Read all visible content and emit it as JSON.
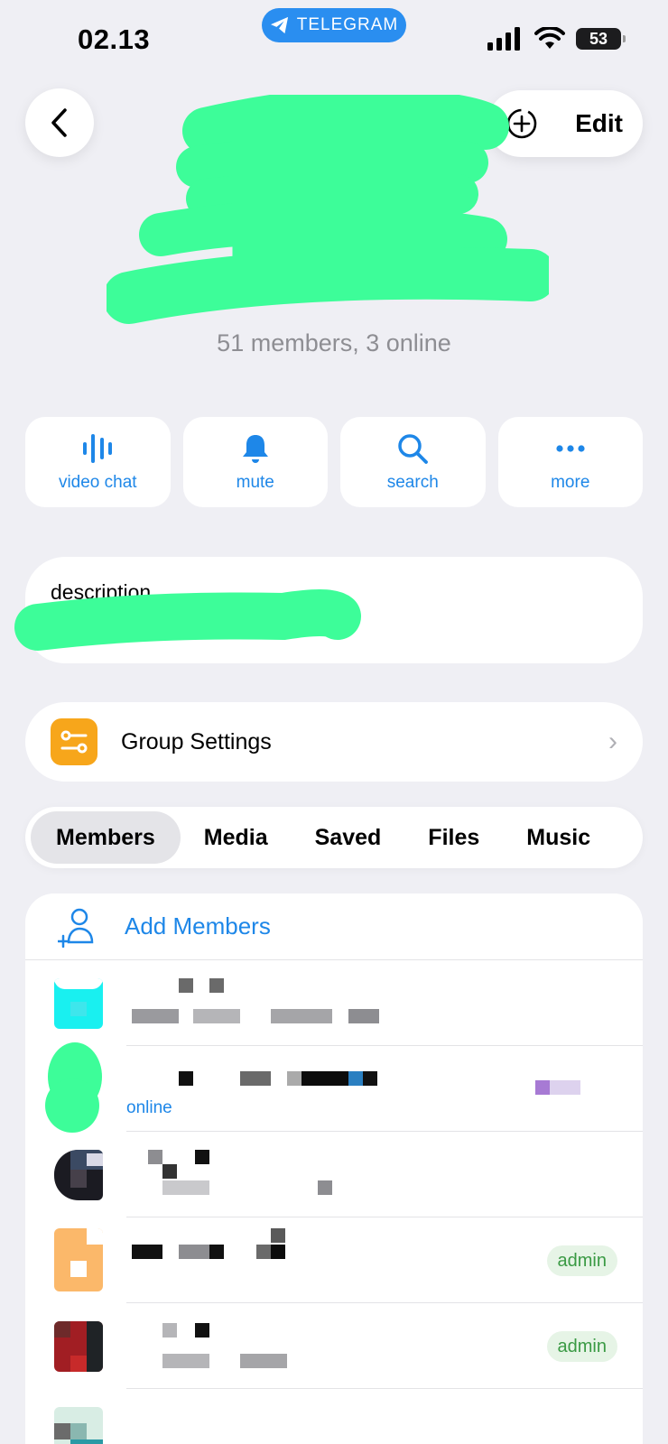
{
  "status_bar": {
    "time": "02.13",
    "app_label": "TELEGRAM",
    "battery": "53"
  },
  "header": {
    "edit_label": "Edit"
  },
  "group": {
    "subtitle": "51 members, 3 online"
  },
  "actions": [
    {
      "label": "video chat",
      "icon": "voice-wave-icon"
    },
    {
      "label": "mute",
      "icon": "bell-icon"
    },
    {
      "label": "search",
      "icon": "magnifier-icon"
    },
    {
      "label": "more",
      "icon": "more-dots-icon"
    }
  ],
  "description": {
    "label": "description"
  },
  "settings": {
    "label": "Group Settings"
  },
  "tabs": [
    {
      "label": "Members",
      "active": true
    },
    {
      "label": "Media"
    },
    {
      "label": "Saved"
    },
    {
      "label": "Files"
    },
    {
      "label": "Music"
    }
  ],
  "members": {
    "add_label": "Add Members",
    "rows": [
      {
        "status": ""
      },
      {
        "status": "online"
      },
      {
        "status": ""
      },
      {
        "status": "",
        "badge": "admin"
      },
      {
        "status": "",
        "badge": "admin"
      }
    ]
  },
  "colors": {
    "accent": "#1e87e8",
    "redaction": "#3dfd99",
    "settings_icon": "#f7a61b",
    "admin_badge": "#3a9a44"
  }
}
